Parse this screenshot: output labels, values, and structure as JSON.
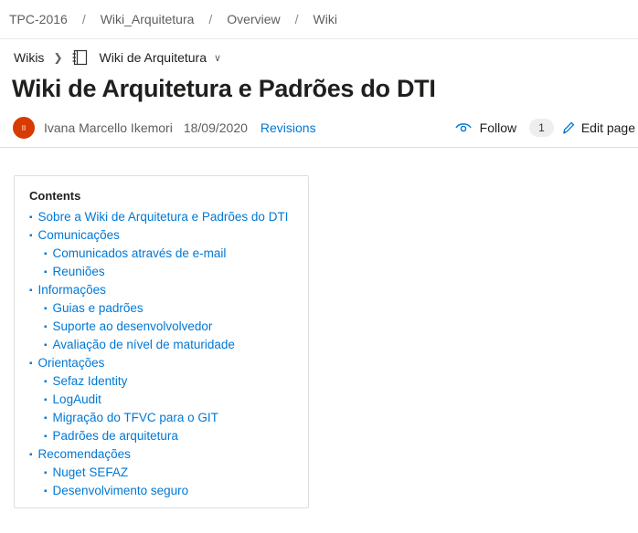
{
  "breadcrumb": {
    "items": [
      "TPC-2016",
      "Wiki_Arquitetura",
      "Overview",
      "Wiki"
    ],
    "separator": "/"
  },
  "wikibar": {
    "wikis_label": "Wikis",
    "chevron_icon": "chevron-right-icon",
    "book_icon": "wiki-book-icon",
    "current_wiki": "Wiki de Arquitetura",
    "dropdown_icon": "chevron-down-icon"
  },
  "page": {
    "title": "Wiki de Arquitetura e Padrões do DTI",
    "author_initials": "II",
    "author": "Ivana Marcello Ikemori",
    "date": "18/09/2020",
    "revisions_label": "Revisions",
    "follow_label": "Follow",
    "follow_count": "1",
    "edit_label": "Edit page"
  },
  "colors": {
    "accent": "#0078d4",
    "avatar": "#d83b01"
  },
  "toc": {
    "heading": "Contents",
    "items": [
      {
        "label": "Sobre a Wiki de Arquitetura e Padrões do DTI",
        "level": 1
      },
      {
        "label": "Comunicações",
        "level": 1
      },
      {
        "label": "Comunicados através de e-mail",
        "level": 2
      },
      {
        "label": "Reuniões",
        "level": 2
      },
      {
        "label": "Informações",
        "level": 1
      },
      {
        "label": "Guias e padrões",
        "level": 2
      },
      {
        "label": "Suporte ao desenvolvolvedor",
        "level": 2
      },
      {
        "label": "Avaliação de nível de maturidade",
        "level": 2
      },
      {
        "label": "Orientações",
        "level": 1
      },
      {
        "label": "Sefaz Identity",
        "level": 2
      },
      {
        "label": "LogAudit",
        "level": 2
      },
      {
        "label": "Migração do TFVC para o GIT",
        "level": 2
      },
      {
        "label": "Padrões de arquitetura",
        "level": 2
      },
      {
        "label": "Recomendações",
        "level": 1
      },
      {
        "label": "Nuget SEFAZ",
        "level": 2
      },
      {
        "label": "Desenvolvimento seguro",
        "level": 2
      }
    ]
  }
}
